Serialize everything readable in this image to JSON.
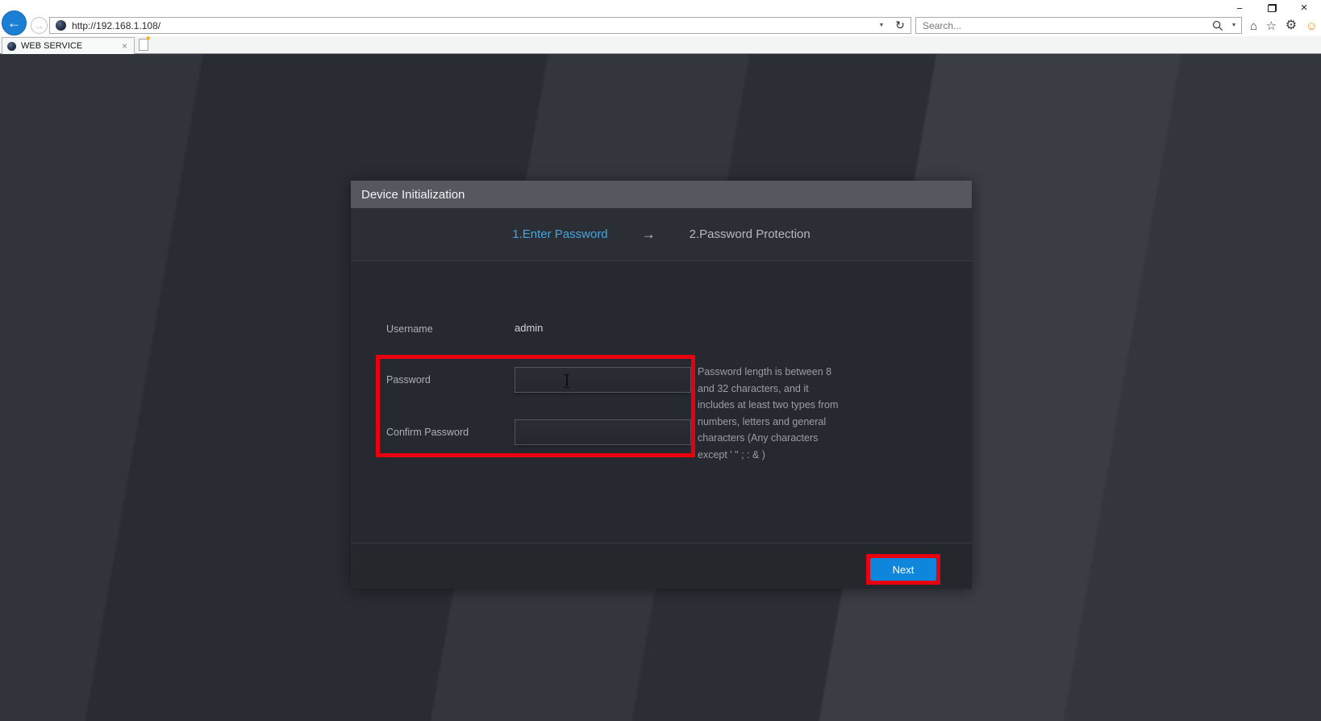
{
  "browser": {
    "window_controls": {
      "minimize": "−",
      "close": "×"
    },
    "address": {
      "url": "http://192.168.1.108/",
      "refresh_icon": "↻",
      "dropdown_icon": "▼"
    },
    "search": {
      "placeholder": "Search...",
      "dropdown_icon": "▼"
    },
    "toolbar_icons": {
      "home": "⌂",
      "favorites": "☆",
      "settings": "⚙",
      "feedback": "☺"
    },
    "nav": {
      "back_icon": "←",
      "forward_icon": "→"
    },
    "tab": {
      "title": "WEB SERVICE",
      "close_icon": "×",
      "new_tab_spark": "★"
    }
  },
  "dialog": {
    "title": "Device Initialization",
    "steps": {
      "step1": "1.Enter Password",
      "arrow": "→",
      "step2": "2.Password Protection"
    },
    "form": {
      "username_label": "Username",
      "username_value": "admin",
      "password_label": "Password",
      "password_value": "",
      "confirm_password_label": "Confirm Password",
      "confirm_password_value": ""
    },
    "hint_lines": [
      "Password length is between 8",
      "and 32 characters, and it",
      "includes at least two types from",
      "numbers, letters and general",
      "characters (Any characters",
      "except  ' \" ; : & )"
    ],
    "next_button": "Next"
  },
  "colors": {
    "step_active_blue": "#41a7e0",
    "next_button_blue": "#0e86dc",
    "annotation_red": "#e8000e",
    "dialog_header_gray": "#55585e",
    "dialog_body_gray": "#26292f",
    "page_background": "#2f3238"
  }
}
